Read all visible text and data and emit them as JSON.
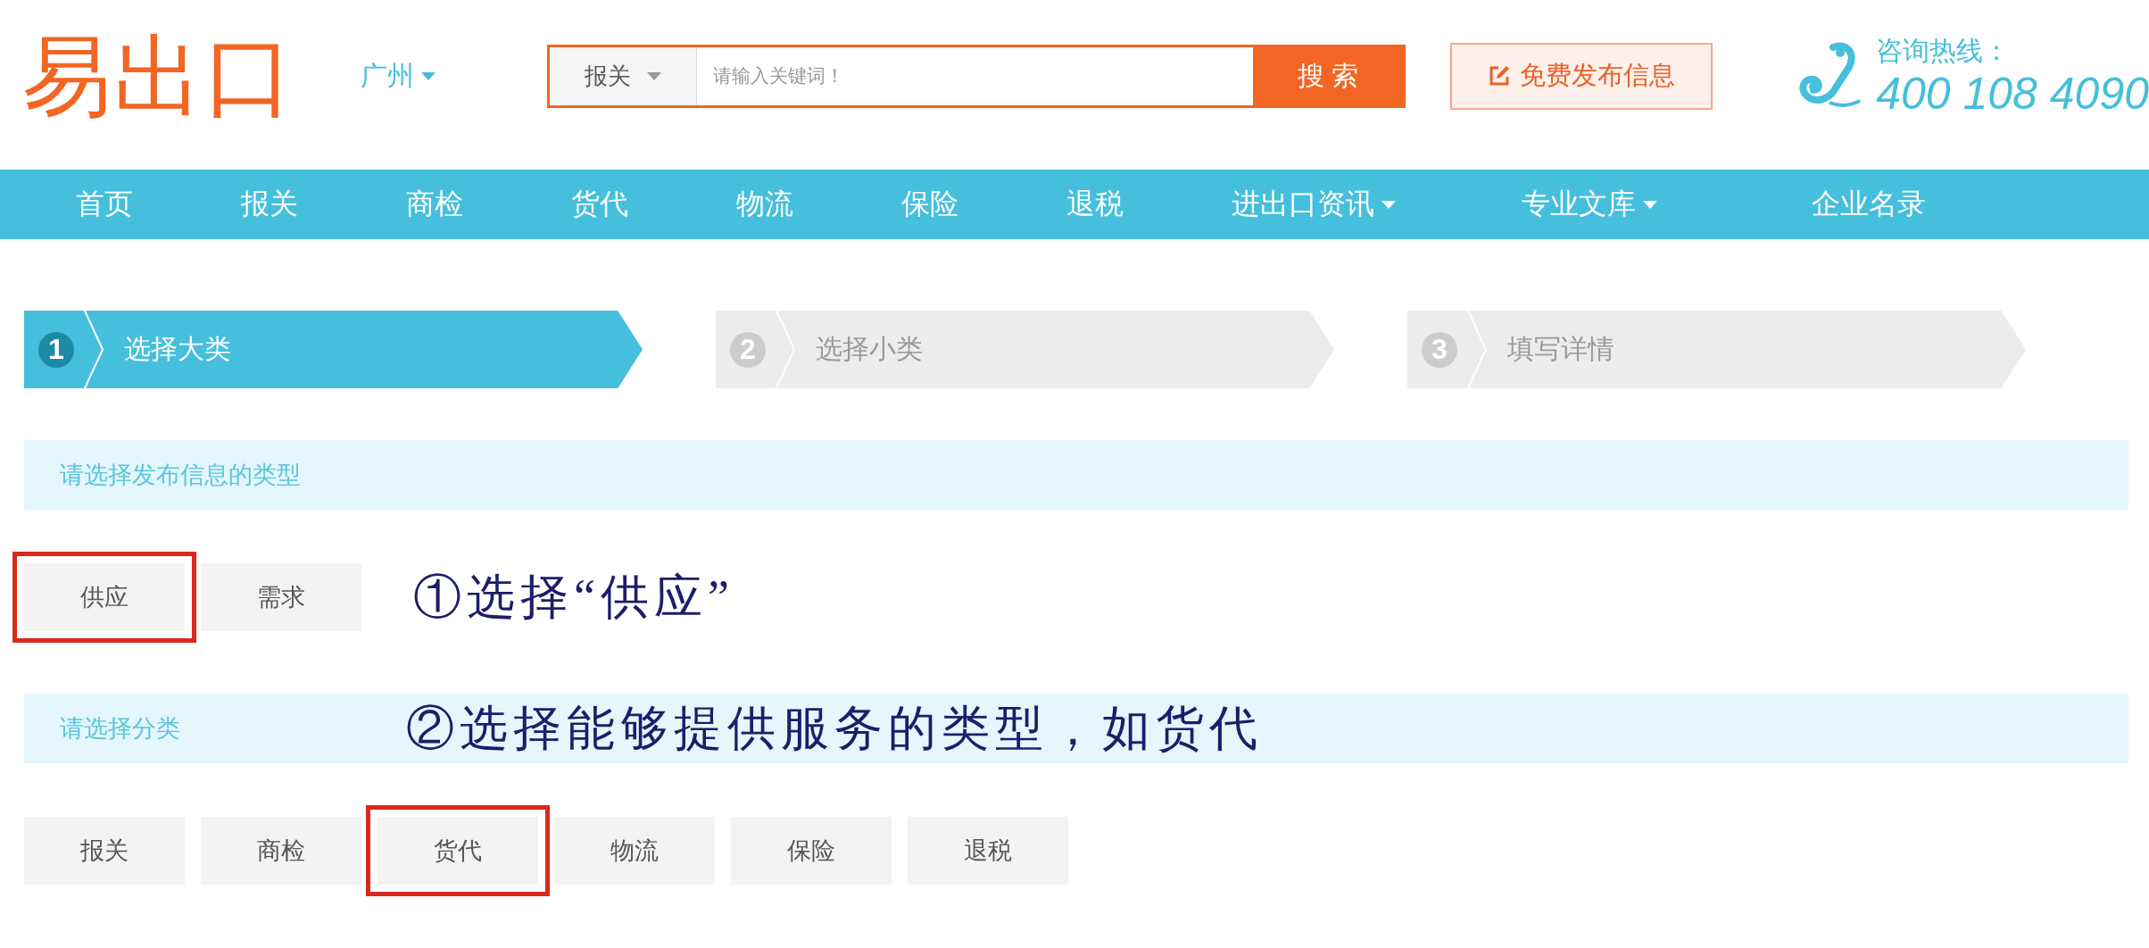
{
  "header": {
    "logo": "易出口",
    "city": "广州",
    "search": {
      "category": "报关",
      "placeholder": "请输入关键词！",
      "button": "搜 索"
    },
    "publish_button": "免费发布信息",
    "hotline": {
      "label": "咨询热线：",
      "number": "400 108 4090"
    }
  },
  "nav": [
    {
      "label": "首页",
      "dropdown": false
    },
    {
      "label": "报关",
      "dropdown": false
    },
    {
      "label": "商检",
      "dropdown": false
    },
    {
      "label": "货代",
      "dropdown": false
    },
    {
      "label": "物流",
      "dropdown": false
    },
    {
      "label": "保险",
      "dropdown": false
    },
    {
      "label": "退税",
      "dropdown": false
    },
    {
      "label": "进出口资讯",
      "dropdown": true
    },
    {
      "label": "专业文库",
      "dropdown": true
    },
    {
      "label": "企业名录",
      "dropdown": false
    }
  ],
  "steps": [
    {
      "number": "1",
      "label": "选择大类",
      "selected": true
    },
    {
      "number": "2",
      "label": "选择小类",
      "selected": false
    },
    {
      "number": "3",
      "label": "填写详情",
      "selected": false
    }
  ],
  "type_section": {
    "title": "请选择发布信息的类型",
    "options": [
      {
        "label": "供应",
        "selected": true
      },
      {
        "label": "需求",
        "selected": false
      }
    ],
    "annotation": "①选择“供应”"
  },
  "category_section": {
    "title": "请选择分类",
    "annotation": "②选择能够提供服务的类型，如货代",
    "options": [
      {
        "label": "报关",
        "selected": false
      },
      {
        "label": "商检",
        "selected": false
      },
      {
        "label": "货代",
        "selected": true
      },
      {
        "label": "物流",
        "selected": false
      },
      {
        "label": "保险",
        "selected": false
      },
      {
        "label": "退税",
        "selected": false
      }
    ]
  }
}
